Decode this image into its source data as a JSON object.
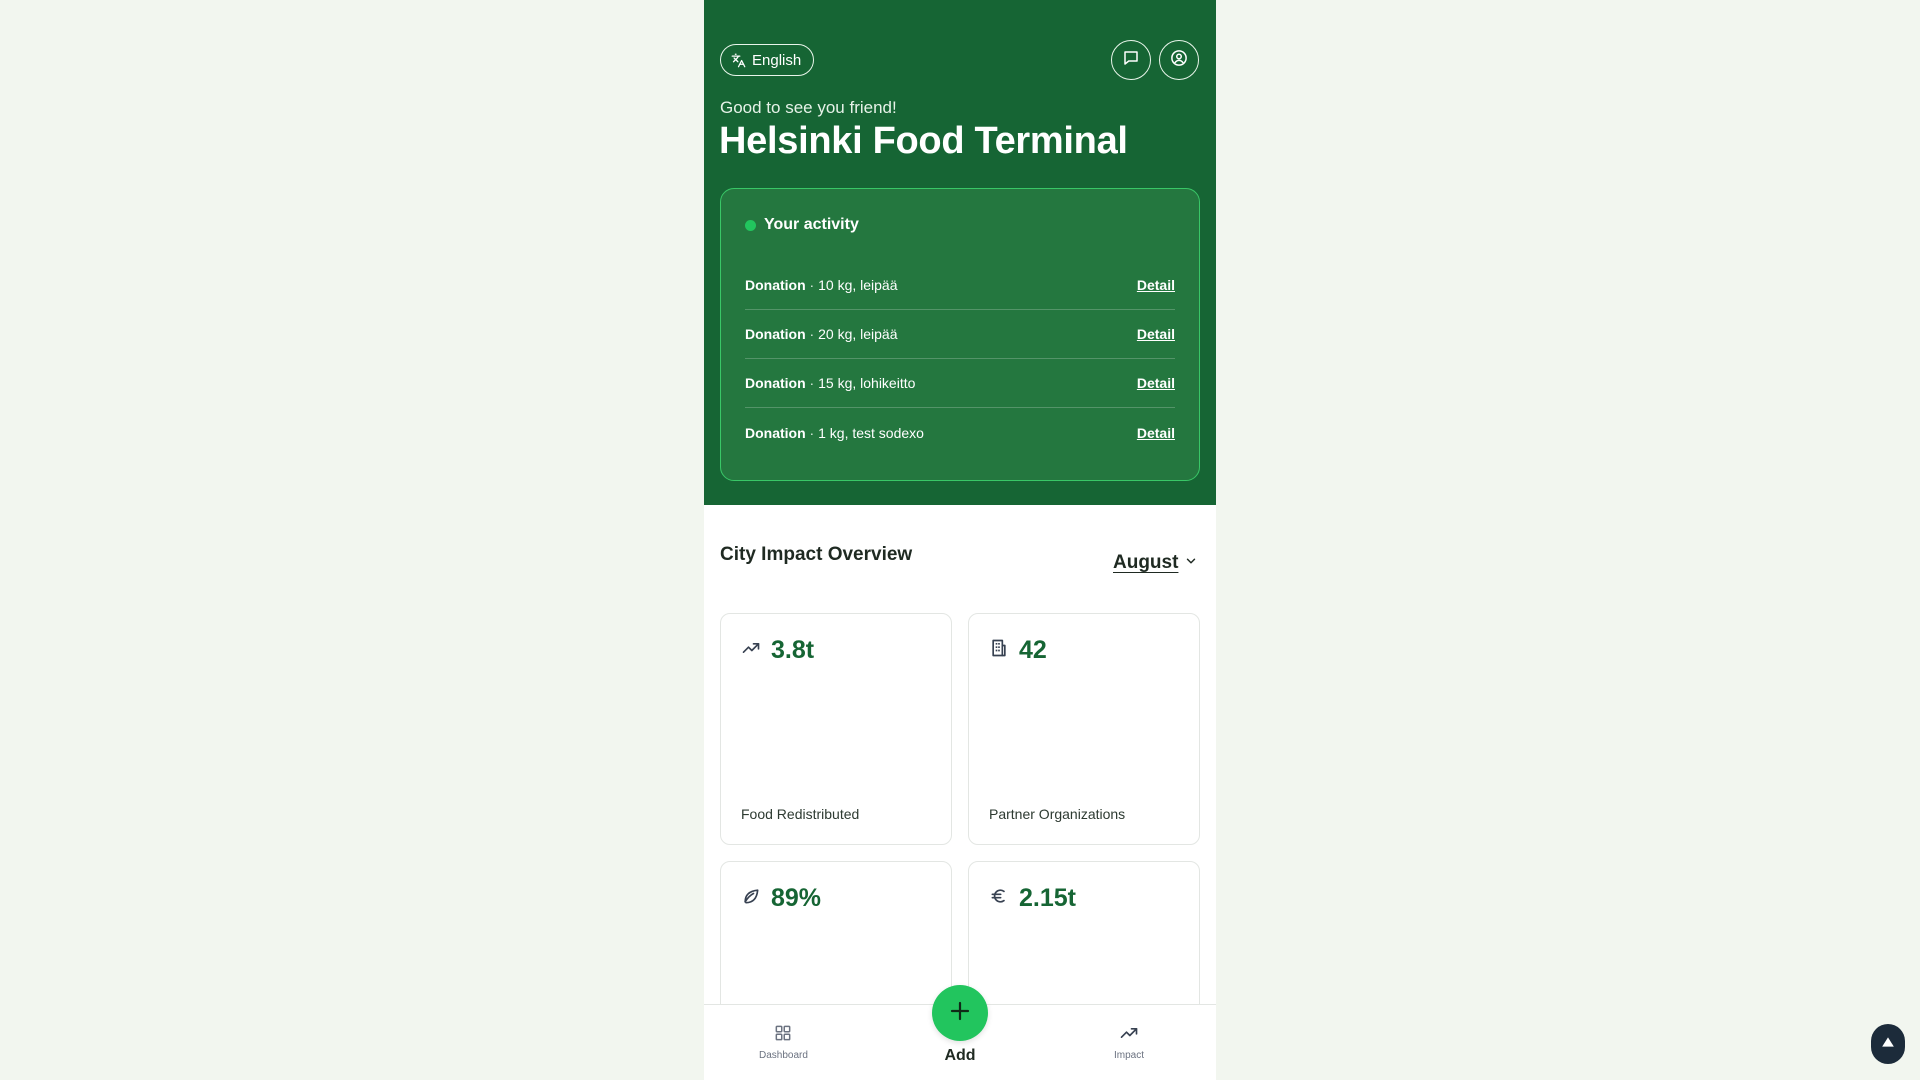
{
  "header": {
    "language_label": "English",
    "greeting": "Good to see you friend!",
    "title": "Helsinki Food Terminal",
    "chat_icon": "chat-bubble-icon",
    "profile_icon": "user-circle-icon",
    "language_icon": "translate-icon"
  },
  "activity": {
    "title": "Your activity",
    "items": [
      {
        "type": "Donation",
        "separator": " · ",
        "desc": "10 kg, leipää",
        "link": "Detail"
      },
      {
        "type": "Donation",
        "separator": " · ",
        "desc": "20 kg, leipää",
        "link": "Detail"
      },
      {
        "type": "Donation",
        "separator": " · ",
        "desc": "15 kg, lohikeitto",
        "link": "Detail"
      },
      {
        "type": "Donation",
        "separator": " · ",
        "desc": "1 kg, test sodexo",
        "link": "Detail"
      }
    ]
  },
  "overview": {
    "title": "City Impact Overview",
    "month": "August",
    "stats": [
      {
        "icon": "trending-up-icon",
        "value": "3.8t",
        "label": "Food Redistributed"
      },
      {
        "icon": "building-icon",
        "value": "42",
        "label": "Partner Organizations"
      },
      {
        "icon": "leaf-icon",
        "value": "89%",
        "label": ""
      },
      {
        "icon": "euro-icon",
        "value": "2.15t",
        "label": ""
      }
    ]
  },
  "nav": {
    "dashboard": "Dashboard",
    "add": "Add",
    "impact": "Impact"
  },
  "colors": {
    "header_bg": "#166534",
    "card_bg": "#24773f",
    "accent": "#22c55e",
    "value_text": "#166534"
  }
}
